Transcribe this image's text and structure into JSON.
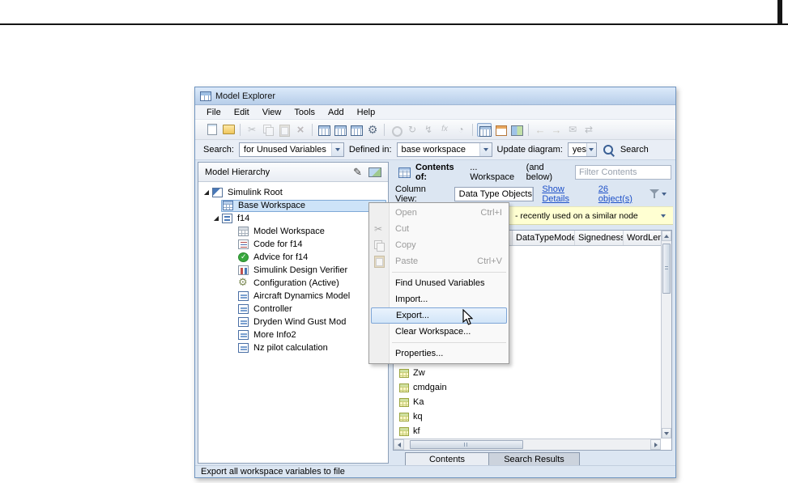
{
  "colors": {
    "titlebar_top": "#dceafa",
    "titlebar_bottom": "#b7cee9",
    "selection": "#cde3f8",
    "link": "#1d50c8",
    "suggestion_bg": "#ffffd2"
  },
  "window": {
    "title": "Model Explorer",
    "status_text": "Export all workspace variables to file"
  },
  "menubar": {
    "items": [
      "File",
      "Edit",
      "View",
      "Tools",
      "Add",
      "Help"
    ]
  },
  "toolbar": {
    "icons": [
      "new-model",
      "open-folder",
      "cut",
      "copy",
      "paste",
      "delete",
      "insert-row",
      "insert-column",
      "edit-table",
      "settings-gear",
      "link",
      "refresh",
      "evaluate",
      "function",
      "history",
      "column-view-toggle",
      "dialog-view",
      "layout-view",
      "navigate-back",
      "navigate-forward",
      "send-mail",
      "sync"
    ]
  },
  "searchbar": {
    "search_label": "Search:",
    "search_value": "for Unused Variables",
    "defined_in_label": "Defined in:",
    "defined_in_value": "base workspace",
    "update_diagram_label": "Update diagram:",
    "update_diagram_value": "yes",
    "search_button_label": "Search"
  },
  "hierarchy": {
    "header": "Model Hierarchy",
    "items": [
      {
        "label": "Simulink Root"
      },
      {
        "label": "Base Workspace"
      },
      {
        "label": "f14"
      },
      {
        "label": "Model Workspace"
      },
      {
        "label": "Code for f14"
      },
      {
        "label": "Advice for f14"
      },
      {
        "label": "Simulink Design Verifier"
      },
      {
        "label": "Configuration (Active)"
      },
      {
        "label": "Aircraft Dynamics Model"
      },
      {
        "label": "Controller"
      },
      {
        "label": "Dryden Wind Gust Mod"
      },
      {
        "label": "More Info2"
      },
      {
        "label": "Nz pilot calculation"
      }
    ]
  },
  "contents": {
    "header_label": "Contents of:",
    "header_value": "... Workspace",
    "header_note": "(and below)",
    "filter_placeholder": "Filter Contents",
    "column_view_label": "Column View:",
    "column_view_value": "Data Type Objects",
    "show_details_link": "Show Details",
    "objects_link": "26 object(s)",
    "suggestion_text": "- recently used on a similar node",
    "table": {
      "columns": [
        "DataTypeMode",
        "Signedness",
        "WordLen"
      ],
      "rows": [
        {
          "name": "Zw"
        },
        {
          "name": "cmdgain"
        },
        {
          "name": "Ka"
        },
        {
          "name": "kq"
        },
        {
          "name": "kf"
        }
      ]
    },
    "tabs": [
      {
        "label": "Contents"
      },
      {
        "label": "Search Results"
      }
    ]
  },
  "context_menu": {
    "items": [
      {
        "label": "Open",
        "shortcut": "Ctrl+I"
      },
      {
        "label": "Cut"
      },
      {
        "label": "Copy"
      },
      {
        "label": "Paste",
        "shortcut": "Ctrl+V"
      },
      {
        "label": "Find Unused Variables"
      },
      {
        "label": "Import..."
      },
      {
        "label": "Export..."
      },
      {
        "label": "Clear Workspace..."
      },
      {
        "label": "Properties..."
      }
    ]
  }
}
